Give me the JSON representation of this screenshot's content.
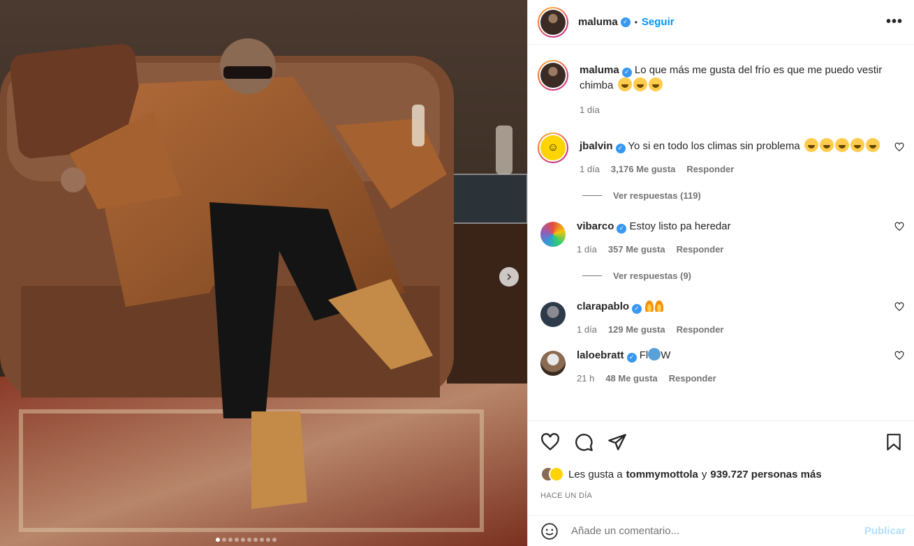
{
  "post": {
    "author": "maluma",
    "follow_label": "Seguir",
    "separator": "•",
    "more_label": "•••",
    "caption": "Lo que más me gusta del frío es que me puedo vestir chimba",
    "caption_time": "1 día",
    "carousel": {
      "total_slides": 10,
      "active_index": 0
    }
  },
  "comments": [
    {
      "username": "jbalvin",
      "text": "Yo si en todo los climas sin problema",
      "emoji_count": 5,
      "time": "1 día",
      "likes": "3,176 Me gusta",
      "reply_label": "Responder",
      "replies_label": "Ver respuestas (119)",
      "avatar_color": "#ffd400"
    },
    {
      "username": "vibarco",
      "text": "Estoy listo pa heredar",
      "emoji_count": 0,
      "time": "1 día",
      "likes": "357 Me gusta",
      "reply_label": "Responder",
      "replies_label": "Ver respuestas (9)",
      "avatar_color": "#6bb36b"
    },
    {
      "username": "clarapablo",
      "text": "",
      "fire_count": 2,
      "time": "1 día",
      "likes": "129 Me gusta",
      "reply_label": "Responder",
      "avatar_color": "#2d3a4a"
    },
    {
      "username": "laloebratt",
      "text_a": "Fl",
      "text_b": "W",
      "time": "21 h",
      "likes": "48 Me gusta",
      "reply_label": "Responder",
      "avatar_color": "#c9a98b"
    }
  ],
  "footer": {
    "likes_prefix": "Les gusta a",
    "likes_user": "tommymottola",
    "likes_connector": "y",
    "likes_rest": "939.727 personas más",
    "time_ago": "HACE UN DÍA",
    "comment_placeholder": "Añade un comentario...",
    "publish_label": "Publicar"
  },
  "colors": {
    "accent": "#0095f6",
    "verified": "#3897f0",
    "muted": "#737373"
  }
}
